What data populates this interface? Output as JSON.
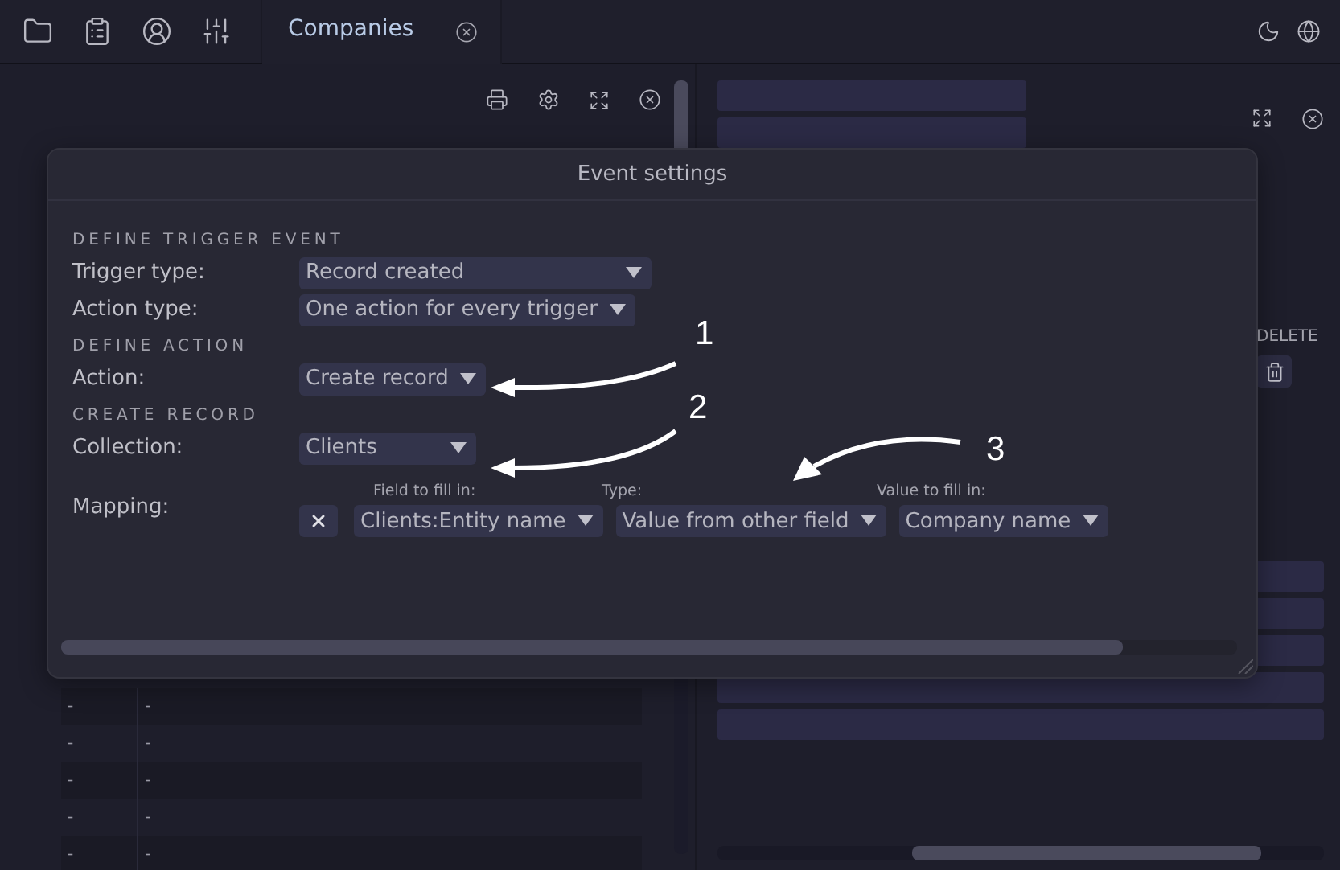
{
  "tabs": [
    {
      "label": "Companies",
      "selected": true
    }
  ],
  "left_panel": {
    "rows": [
      {
        "cells": [
          "-",
          "-"
        ]
      },
      {
        "cells": [
          "-",
          "-"
        ]
      },
      {
        "cells": [
          "-",
          "-"
        ]
      },
      {
        "cells": [
          "-",
          "-"
        ]
      },
      {
        "cells": [
          "-",
          "-"
        ]
      }
    ]
  },
  "right_panel": {
    "column_header": "DELETE"
  },
  "dialog": {
    "title": "Event settings",
    "sections": [
      {
        "heading": "DEFINE TRIGGER EVENT",
        "fields": [
          {
            "label": "Trigger type:",
            "value": "Record created"
          },
          {
            "label": "Action type:",
            "value": "One action for every trigger"
          }
        ]
      },
      {
        "heading": "DEFINE ACTION",
        "fields": [
          {
            "label": "Action:",
            "value": "Create record"
          }
        ]
      },
      {
        "heading": "CREATE RECORD",
        "fields": [
          {
            "label": "Collection:",
            "value": "Clients"
          }
        ]
      }
    ],
    "mapping": {
      "label": "Mapping:",
      "columns": [
        "Field to fill in:",
        "Type:",
        "Value to fill in:"
      ],
      "rows": [
        {
          "field": "Clients:Entity name",
          "type": "Value from other field",
          "value": "Company name"
        }
      ]
    }
  },
  "annotations": [
    {
      "label": "1"
    },
    {
      "label": "2"
    },
    {
      "label": "3"
    }
  ]
}
